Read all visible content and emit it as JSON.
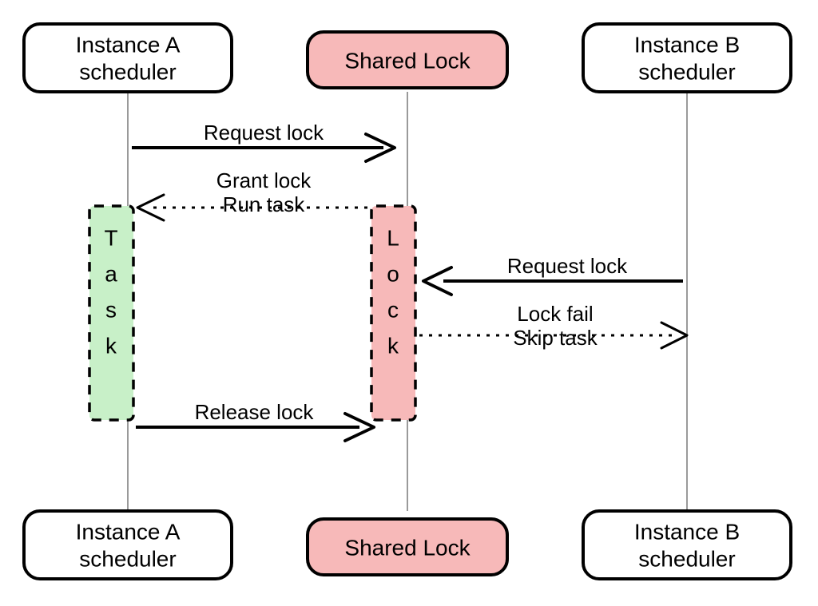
{
  "participants": {
    "instanceA": {
      "label_line1": "Instance A",
      "label_line2": "scheduler"
    },
    "sharedLock": {
      "label": "Shared Lock"
    },
    "instanceB": {
      "label_line1": "Instance B",
      "label_line2": "scheduler"
    }
  },
  "activations": {
    "task": {
      "label": "Task"
    },
    "lock": {
      "label": "Lock"
    }
  },
  "messages": {
    "requestLockA": "Request lock",
    "grantLock_line1": "Grant lock",
    "grantLock_line2": "Run task",
    "requestLockB": "Request lock",
    "lockFail_line1": "Lock fail",
    "lockFail_line2": "Skip task",
    "releaseLock": "Release lock"
  },
  "colors": {
    "sharedFill": "#f7b9b9",
    "taskFill": "#c8f0c8"
  }
}
